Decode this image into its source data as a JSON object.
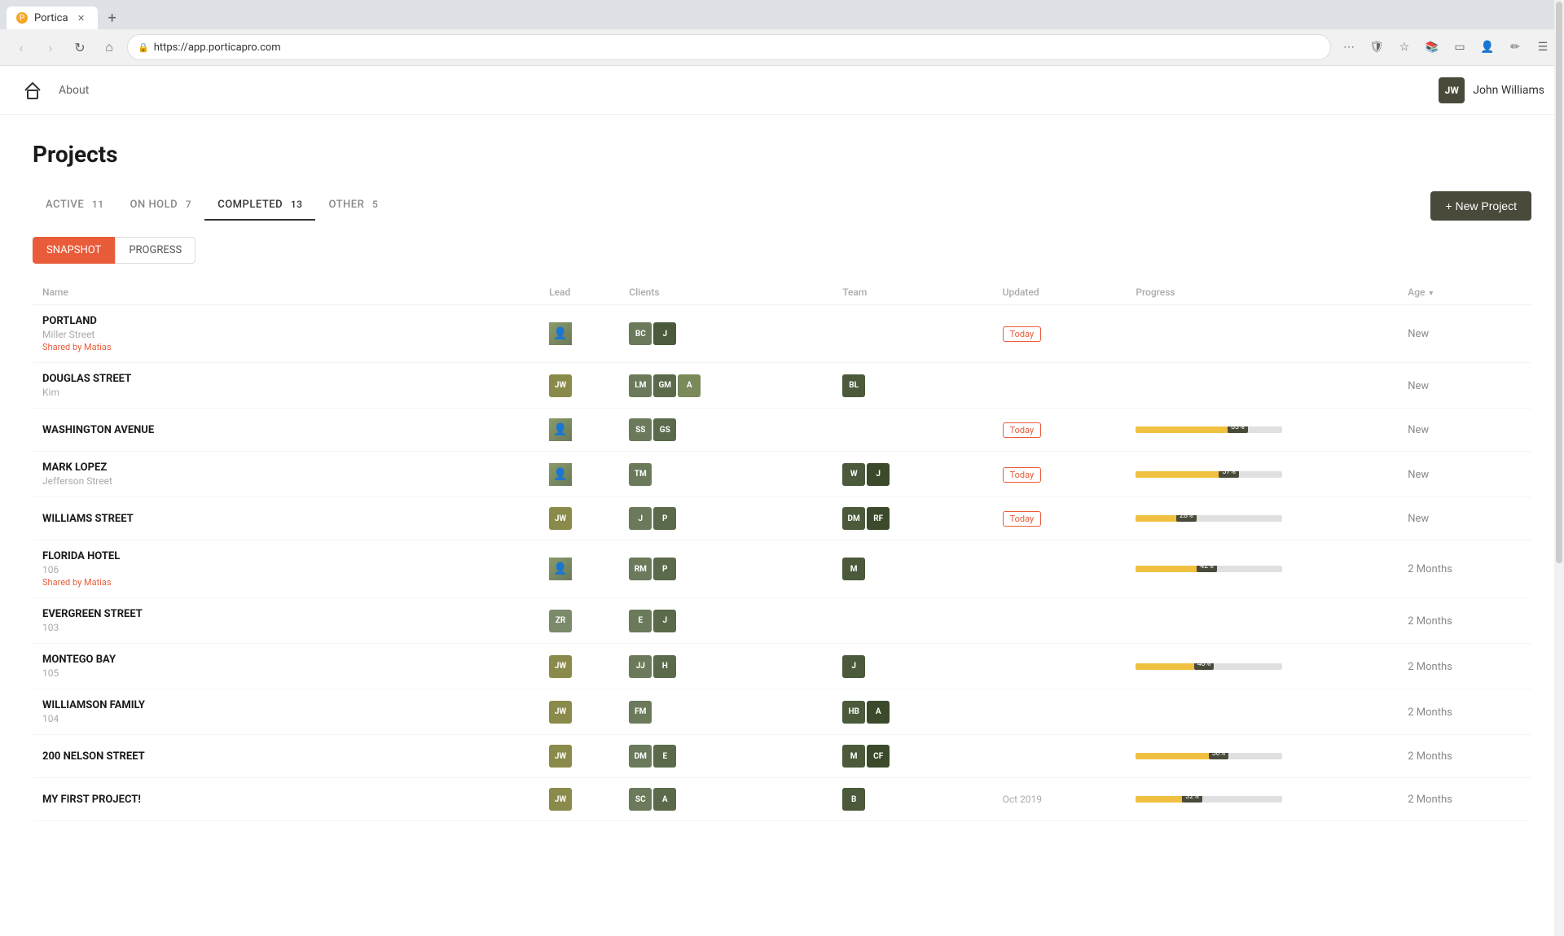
{
  "browser": {
    "tab_label": "Portica",
    "url": "https://app.porticapro.com",
    "new_tab_icon": "+",
    "nav": {
      "back": "‹",
      "forward": "›",
      "refresh": "↻",
      "home": "⌂"
    },
    "toolbar_icons": [
      "⋯",
      "🛡",
      "☆",
      "📚",
      "▭",
      "☆",
      "⋮"
    ]
  },
  "app": {
    "nav_link": "About",
    "user": {
      "initials": "JW",
      "name": "John Williams"
    },
    "logo_icon": "⌂"
  },
  "page": {
    "title": "Projects",
    "new_project_label": "+ New Project",
    "tabs": [
      {
        "label": "ACTIVE",
        "count": "11",
        "active": false
      },
      {
        "label": "ON HOLD",
        "count": "7",
        "active": false
      },
      {
        "label": "COMPLETED",
        "count": "13",
        "active": true
      },
      {
        "label": "OTHER",
        "count": "5",
        "active": false
      }
    ],
    "view_toggles": [
      {
        "label": "SNAPSHOT",
        "active": true
      },
      {
        "label": "PROGRESS",
        "active": false
      }
    ],
    "table": {
      "columns": [
        {
          "label": "Name",
          "key": "name"
        },
        {
          "label": "Lead",
          "key": "lead"
        },
        {
          "label": "Clients",
          "key": "clients"
        },
        {
          "label": "Team",
          "key": "team"
        },
        {
          "label": "Updated",
          "key": "updated"
        },
        {
          "label": "Progress",
          "key": "progress"
        },
        {
          "label": "Age",
          "key": "age",
          "sort": true
        }
      ],
      "rows": [
        {
          "name": "PORTLAND",
          "sub": "Miller Street",
          "shared": "Shared by Matias",
          "lead_initials": "photo1",
          "lead_color": "#8a9a6a",
          "clients": [
            {
              "initials": "BC",
              "color": "#6a7a5a"
            },
            {
              "initials": "J",
              "color": "#4a5a3a"
            }
          ],
          "team": [],
          "updated": "Today",
          "progress": null,
          "age": "New"
        },
        {
          "name": "DOUGLAS STREET",
          "sub": "Kim",
          "shared": "",
          "lead_initials": "JW",
          "lead_color": "#8a8a4a",
          "clients": [
            {
              "initials": "LM",
              "color": "#6a7a5a"
            },
            {
              "initials": "GM",
              "color": "#5a6a4a"
            },
            {
              "initials": "A",
              "color": "#7a8a5a"
            }
          ],
          "team": [
            {
              "initials": "BL",
              "color": "#4a5a3a"
            }
          ],
          "updated": "",
          "progress": null,
          "age": "New"
        },
        {
          "name": "WASHINGTON AVENUE",
          "sub": "",
          "shared": "",
          "lead_initials": "photo2",
          "lead_color": "#9a8a7a",
          "clients": [
            {
              "initials": "SS",
              "color": "#6a7a5a"
            },
            {
              "initials": "GS",
              "color": "#5a6a4a"
            }
          ],
          "team": [],
          "updated": "Today",
          "progress": 63,
          "age": "New"
        },
        {
          "name": "MARK LOPEZ",
          "sub": "Jefferson Street",
          "shared": "",
          "lead_initials": "photo3",
          "lead_color": "#7a9a8a",
          "clients": [
            {
              "initials": "TM",
              "color": "#6a7a5a"
            }
          ],
          "team": [
            {
              "initials": "W",
              "color": "#4a5a3a"
            },
            {
              "initials": "J",
              "color": "#3a4a2a"
            }
          ],
          "updated": "Today",
          "progress": 57,
          "age": "New"
        },
        {
          "name": "WILLIAMS STREET",
          "sub": "",
          "shared": "",
          "lead_initials": "JW",
          "lead_color": "#8a8a4a",
          "clients": [
            {
              "initials": "J",
              "color": "#6a7a5a"
            },
            {
              "initials": "P",
              "color": "#5a6a4a"
            }
          ],
          "team": [
            {
              "initials": "DM",
              "color": "#4a5a3a"
            },
            {
              "initials": "RF",
              "color": "#3a4a2a"
            }
          ],
          "updated": "Today",
          "progress": 28,
          "age": "New"
        },
        {
          "name": "FLORIDA HOTEL",
          "sub": "106",
          "shared": "Shared by Matias",
          "lead_initials": "photo4",
          "lead_color": "#9a8a7a",
          "clients": [
            {
              "initials": "RM",
              "color": "#6a7a5a"
            },
            {
              "initials": "P",
              "color": "#5a6a4a"
            }
          ],
          "team": [
            {
              "initials": "M",
              "color": "#4a5a3a"
            }
          ],
          "updated": "",
          "progress": 42,
          "age": "2 Months"
        },
        {
          "name": "EVERGREEN STREET",
          "sub": "103",
          "shared": "",
          "lead_initials": "ZR",
          "lead_color": "#7a8a6a",
          "clients": [
            {
              "initials": "E",
              "color": "#6a7a5a"
            },
            {
              "initials": "J",
              "color": "#5a6a4a"
            }
          ],
          "team": [],
          "updated": "",
          "progress": null,
          "age": "2 Months"
        },
        {
          "name": "MONTEGO BAY",
          "sub": "105",
          "shared": "",
          "lead_initials": "JW",
          "lead_color": "#8a8a4a",
          "clients": [
            {
              "initials": "JJ",
              "color": "#6a7a5a"
            },
            {
              "initials": "H",
              "color": "#5a6a4a"
            }
          ],
          "team": [
            {
              "initials": "J",
              "color": "#4a5a3a"
            }
          ],
          "updated": "",
          "progress": 40,
          "age": "2 Months"
        },
        {
          "name": "WILLIAMSON FAMILY",
          "sub": "104",
          "shared": "",
          "lead_initials": "JW",
          "lead_color": "#8a8a4a",
          "clients": [
            {
              "initials": "FM",
              "color": "#6a7a5a"
            }
          ],
          "team": [
            {
              "initials": "HB",
              "color": "#4a5a3a"
            },
            {
              "initials": "A",
              "color": "#3a4a2a"
            }
          ],
          "updated": "",
          "progress": null,
          "age": "2 Months"
        },
        {
          "name": "200 NELSON STREET",
          "sub": "",
          "shared": "",
          "lead_initials": "JW",
          "lead_color": "#8a8a4a",
          "clients": [
            {
              "initials": "DM",
              "color": "#6a7a5a"
            },
            {
              "initials": "E",
              "color": "#5a6a4a"
            }
          ],
          "team": [
            {
              "initials": "M",
              "color": "#4a5a3a"
            },
            {
              "initials": "CF",
              "color": "#3a4a2a"
            }
          ],
          "updated": "",
          "progress": 50,
          "age": "2 Months"
        },
        {
          "name": "MY FIRST PROJECT!",
          "sub": "",
          "shared": "",
          "lead_initials": "JW",
          "lead_color": "#8a8a4a",
          "clients": [
            {
              "initials": "SC",
              "color": "#6a7a5a"
            },
            {
              "initials": "A",
              "color": "#5a6a4a"
            }
          ],
          "team": [
            {
              "initials": "B",
              "color": "#4a5a3a"
            }
          ],
          "updated": "Oct 2019",
          "progress": 32,
          "age": "2 Months"
        }
      ]
    }
  }
}
